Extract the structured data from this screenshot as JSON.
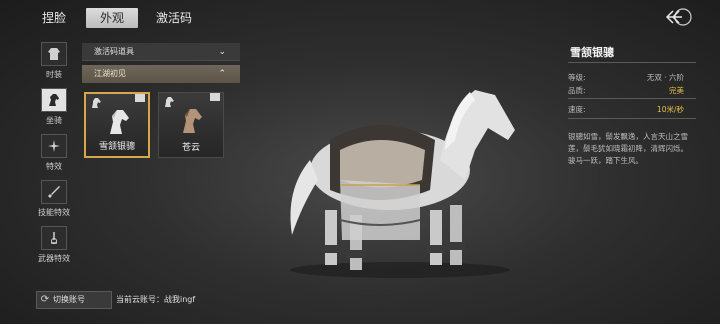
{
  "tabs": [
    {
      "label": "捏脸"
    },
    {
      "label": "外观"
    },
    {
      "label": "激活码"
    }
  ],
  "sidebar": {
    "items": [
      {
        "label": "时装"
      },
      {
        "label": "坐骑"
      },
      {
        "label": "特效"
      },
      {
        "label": "技能特效"
      },
      {
        "label": "武器特效"
      }
    ]
  },
  "list": {
    "dropdown1": "激活码道具",
    "dropdown2": "江湖初见",
    "cards": [
      {
        "name": "雪颔银骢"
      },
      {
        "name": "苍云"
      }
    ]
  },
  "detail": {
    "title": "雪颔银骢",
    "rows": [
      {
        "label": "等级:",
        "value": "无双 · 六阶"
      },
      {
        "label": "品质:",
        "value": "完美"
      },
      {
        "label": "速度:",
        "value": "10米/秒"
      }
    ],
    "description": "银骢如雪，鬃发飘逸，人言天山之雪莲，鬃毛犹如晓霜初降，清辉闪烁。骏马一跃，踏下生风。"
  },
  "footer": {
    "switch_label": "切换账号",
    "account_label": "当前云账号：",
    "account_name": "战我ingf"
  },
  "colors": {
    "accent_gold": "#e6c14a",
    "selected_border": "#d6a84a"
  }
}
